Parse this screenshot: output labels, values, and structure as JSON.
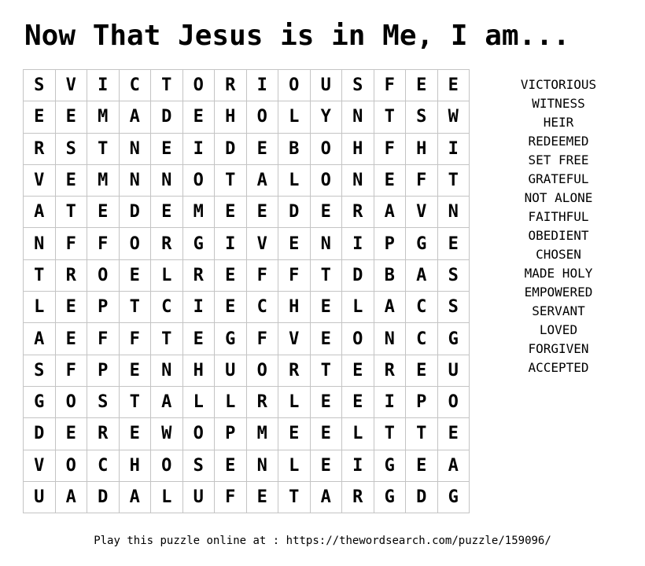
{
  "title": "Now That Jesus is in Me, I am...",
  "grid": [
    [
      "S",
      "V",
      "I",
      "C",
      "T",
      "O",
      "R",
      "I",
      "O",
      "U",
      "S",
      "F",
      "E",
      "E"
    ],
    [
      "E",
      "E",
      "M",
      "A",
      "D",
      "E",
      "H",
      "O",
      "L",
      "Y",
      "N",
      "T",
      "S",
      "W"
    ],
    [
      "R",
      "S",
      "T",
      "N",
      "E",
      "I",
      "D",
      "E",
      "B",
      "O",
      "H",
      "F",
      "H",
      "I"
    ],
    [
      "V",
      "E",
      "M",
      "N",
      "N",
      "O",
      "T",
      "A",
      "L",
      "O",
      "N",
      "E",
      "F",
      "T"
    ],
    [
      "A",
      "T",
      "E",
      "D",
      "E",
      "M",
      "E",
      "E",
      "D",
      "E",
      "R",
      "A",
      "V",
      "N"
    ],
    [
      "N",
      "F",
      "F",
      "O",
      "R",
      "G",
      "I",
      "V",
      "E",
      "N",
      "I",
      "P",
      "G",
      "E"
    ],
    [
      "T",
      "R",
      "O",
      "E",
      "L",
      "R",
      "E",
      "F",
      "F",
      "T",
      "D",
      "B",
      "A",
      "S"
    ],
    [
      "L",
      "E",
      "P",
      "T",
      "C",
      "I",
      "E",
      "C",
      "H",
      "E",
      "L",
      "A",
      "C",
      "S"
    ],
    [
      "A",
      "E",
      "F",
      "F",
      "T",
      "E",
      "G",
      "F",
      "V",
      "E",
      "O",
      "N",
      "C",
      "G"
    ],
    [
      "S",
      "F",
      "P",
      "E",
      "N",
      "H",
      "U",
      "O",
      "R",
      "T",
      "E",
      "R",
      "E",
      "U"
    ],
    [
      "G",
      "O",
      "S",
      "T",
      "A",
      "L",
      "L",
      "R",
      "L",
      "E",
      "E",
      "I",
      "P",
      "O"
    ],
    [
      "D",
      "E",
      "R",
      "E",
      "W",
      "O",
      "P",
      "M",
      "E",
      "E",
      "L",
      "T",
      "T",
      "E"
    ],
    [
      "V",
      "O",
      "C",
      "H",
      "O",
      "S",
      "E",
      "N",
      "L",
      "E",
      "I",
      "G",
      "E",
      "A"
    ],
    [
      "U",
      "A",
      "D",
      "A",
      "L",
      "U",
      "F",
      "E",
      "T",
      "A",
      "R",
      "G",
      "D",
      "G"
    ]
  ],
  "words": [
    "VICTORIOUS",
    "WITNESS",
    "HEIR",
    "REDEEMED",
    "SET FREE",
    "GRATEFUL",
    "NOT ALONE",
    "FAITHFUL",
    "OBEDIENT",
    "CHOSEN",
    "MADE HOLY",
    "EMPOWERED",
    "SERVANT",
    "LOVED",
    "FORGIVEN",
    "ACCEPTED"
  ],
  "footer": "Play this puzzle online at : https://thewordsearch.com/puzzle/159096/"
}
